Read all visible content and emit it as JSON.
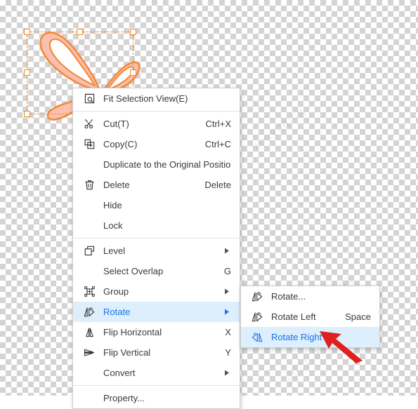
{
  "app": {
    "canvas_background": "transparent-checkerboard",
    "watermark_text": "zouyuqing",
    "watermark_text_alt": "2021-09  14:39"
  },
  "artwork": {
    "name": "ribbon-bow-shape",
    "fill_color": "#fbbfae",
    "stroke_color": "#f28a3c"
  },
  "selection": {
    "handle_color": "#f08a24",
    "handle_count": 8
  },
  "context_menu": {
    "name": "object-context-menu",
    "items": [
      {
        "id": "fit-selection-view",
        "label": "Fit Selection View(E)",
        "accel": "",
        "icon": "fit-selection-icon",
        "submenu": false,
        "highlight": false,
        "separator_after": true
      },
      {
        "id": "cut",
        "label": "Cut(T)",
        "accel": "Ctrl+X",
        "icon": "scissors-icon",
        "submenu": false,
        "highlight": false,
        "separator_after": false
      },
      {
        "id": "copy",
        "label": "Copy(C)",
        "accel": "Ctrl+C",
        "icon": "copy-icon",
        "submenu": false,
        "highlight": false,
        "separator_after": false
      },
      {
        "id": "duplicate-original-position",
        "label": "Duplicate to the Original Position",
        "accel": "",
        "icon": "",
        "submenu": false,
        "highlight": false,
        "separator_after": false
      },
      {
        "id": "delete",
        "label": "Delete",
        "accel": "Delete",
        "icon": "trash-icon",
        "submenu": false,
        "highlight": false,
        "separator_after": false
      },
      {
        "id": "hide",
        "label": "Hide",
        "accel": "",
        "icon": "",
        "submenu": false,
        "highlight": false,
        "separator_after": false
      },
      {
        "id": "lock",
        "label": "Lock",
        "accel": "",
        "icon": "",
        "submenu": false,
        "highlight": false,
        "separator_after": true
      },
      {
        "id": "level",
        "label": "Level",
        "accel": "",
        "icon": "layers-icon",
        "submenu": true,
        "highlight": false,
        "separator_after": false
      },
      {
        "id": "select-overlap",
        "label": "Select Overlap",
        "accel": "G",
        "icon": "",
        "submenu": false,
        "highlight": false,
        "separator_after": false
      },
      {
        "id": "group",
        "label": "Group",
        "accel": "",
        "icon": "group-icon",
        "submenu": true,
        "highlight": false,
        "separator_after": false
      },
      {
        "id": "rotate",
        "label": "Rotate",
        "accel": "",
        "icon": "rotate-icon",
        "submenu": true,
        "highlight": true,
        "separator_after": false
      },
      {
        "id": "flip-horizontal",
        "label": "Flip Horizontal",
        "accel": "X",
        "icon": "flip-horizontal-icon",
        "submenu": false,
        "highlight": false,
        "separator_after": false
      },
      {
        "id": "flip-vertical",
        "label": "Flip Vertical",
        "accel": "Y",
        "icon": "flip-vertical-icon",
        "submenu": false,
        "highlight": false,
        "separator_after": false
      },
      {
        "id": "convert",
        "label": "Convert",
        "accel": "",
        "icon": "",
        "submenu": true,
        "highlight": false,
        "separator_after": true
      },
      {
        "id": "property",
        "label": "Property...",
        "accel": "",
        "icon": "",
        "submenu": false,
        "highlight": false,
        "separator_after": false
      }
    ]
  },
  "rotate_submenu": {
    "name": "rotate-submenu",
    "items": [
      {
        "id": "rotate-dialog",
        "label": "Rotate...",
        "accel": "",
        "icon": "rotate-icon",
        "highlight": false
      },
      {
        "id": "rotate-left",
        "label": "Rotate Left",
        "accel": "Space",
        "icon": "rotate-left-icon",
        "highlight": false
      },
      {
        "id": "rotate-right",
        "label": "Rotate Right",
        "accel": "",
        "icon": "rotate-right-icon",
        "highlight": true
      }
    ]
  },
  "annotation": {
    "arrow_color": "#e01f1f",
    "points_to": "Rotate Right"
  },
  "colors": {
    "highlight_bg": "#ddeefc",
    "highlight_text": "#1a73e8",
    "menu_bg": "#ffffff",
    "menu_border": "#d0d0d0",
    "text": "#3a3a3a"
  }
}
